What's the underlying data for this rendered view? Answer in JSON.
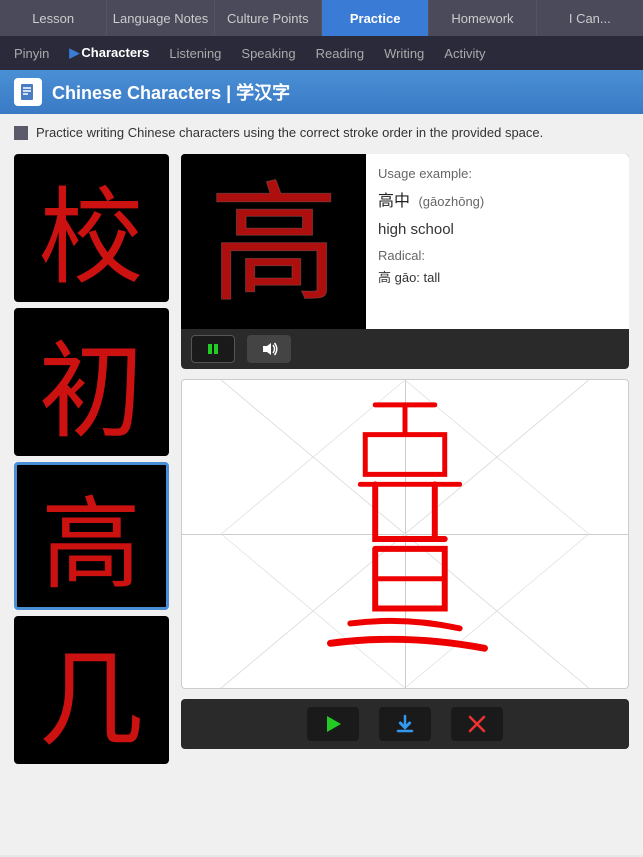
{
  "topNav": {
    "items": [
      {
        "id": "lesson",
        "label": "Lesson",
        "active": false
      },
      {
        "id": "language-notes",
        "label": "Language Notes",
        "active": false
      },
      {
        "id": "culture-points",
        "label": "Culture Points",
        "active": false
      },
      {
        "id": "practice",
        "label": "Practice",
        "active": true
      },
      {
        "id": "homework",
        "label": "Homework",
        "active": false
      },
      {
        "id": "i-can",
        "label": "I Can...",
        "active": false
      }
    ]
  },
  "subNav": {
    "items": [
      {
        "id": "pinyin",
        "label": "Pinyin",
        "active": false,
        "hasArrow": false
      },
      {
        "id": "characters",
        "label": "Characters",
        "active": true,
        "hasArrow": true
      },
      {
        "id": "listening",
        "label": "Listening",
        "active": false,
        "hasArrow": false
      },
      {
        "id": "speaking",
        "label": "Speaking",
        "active": false,
        "hasArrow": false
      },
      {
        "id": "reading",
        "label": "Reading",
        "active": false,
        "hasArrow": false
      },
      {
        "id": "writing",
        "label": "Writing",
        "active": false,
        "hasArrow": false
      },
      {
        "id": "activity",
        "label": "Activity",
        "active": false,
        "hasArrow": false
      }
    ]
  },
  "pageTitle": "Chinese Characters | 学汉字",
  "instruction": "Practice writing Chinese characters using the correct stroke order in the provided space.",
  "characters": [
    {
      "id": "jiao",
      "char": "校",
      "selected": false
    },
    {
      "id": "chu",
      "char": "初",
      "selected": false
    },
    {
      "id": "gao",
      "char": "高",
      "selected": true
    },
    {
      "id": "ji",
      "char": "几",
      "selected": false
    }
  ],
  "usage": {
    "label": "Usage example:",
    "chinese": "高中",
    "pinyin": "(gāozhōng)",
    "english": "high school",
    "radicalLabel": "Radical:",
    "radicalText": "高 gāo: tall"
  },
  "controls": {
    "play": "▶",
    "pause": "⏸",
    "volume": "🔊",
    "download": "⬇",
    "delete": "✕"
  }
}
